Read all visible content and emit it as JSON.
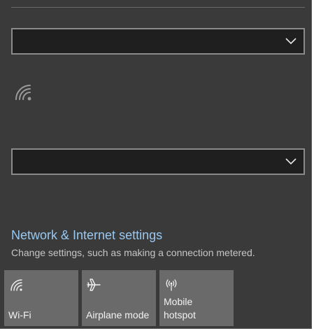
{
  "network": {
    "settings_link": "Network & Internet settings",
    "settings_description": "Change settings, such as making a connection metered."
  },
  "quick_actions": [
    {
      "label": "Wi-Fi",
      "icon": "wifi-icon"
    },
    {
      "label": "Airplane mode",
      "icon": "airplane-icon"
    },
    {
      "label": "Mobile\nhotspot",
      "icon": "mobile-hotspot-icon"
    }
  ],
  "colors": {
    "flyout_background": "#3a3a3a",
    "tile_background": "#6a6a6a",
    "link_color": "#99c8f0",
    "dropdown_border": "#8a8a8a"
  }
}
